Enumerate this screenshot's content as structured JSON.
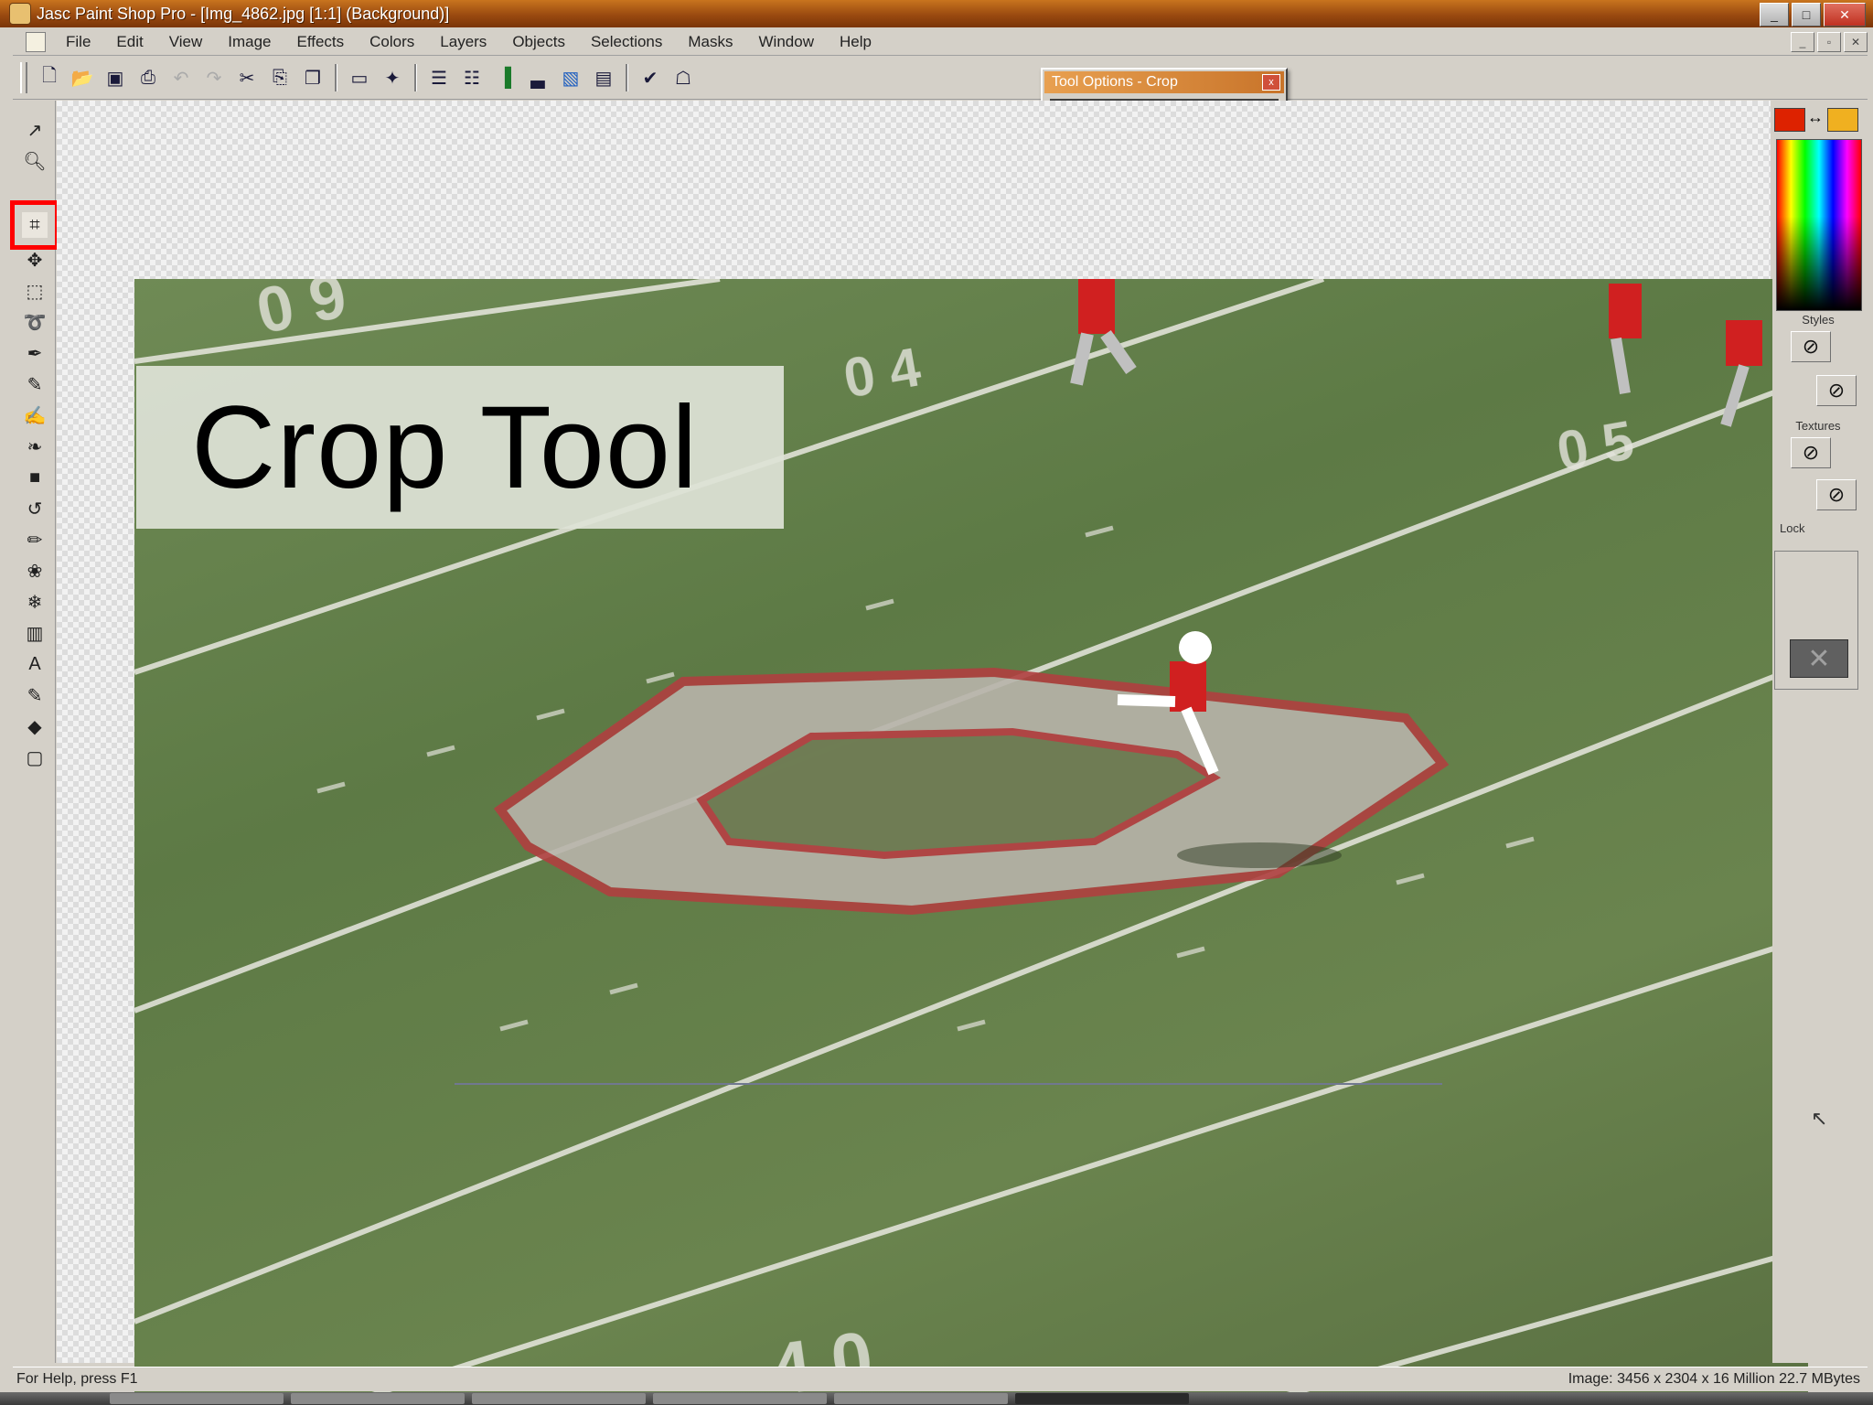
{
  "window": {
    "title": "Jasc Paint Shop Pro - [Img_4862.jpg [1:1] (Background)]",
    "controls": [
      "_",
      "□",
      "✕"
    ]
  },
  "menubar": {
    "items": [
      "File",
      "Edit",
      "View",
      "Image",
      "Effects",
      "Colors",
      "Layers",
      "Objects",
      "Selections",
      "Masks",
      "Window",
      "Help"
    ],
    "mdi_controls": [
      "_",
      "▫",
      "✕"
    ]
  },
  "toolbar": {
    "buttons": [
      "new-icon",
      "open-icon",
      "save-icon",
      "print-icon",
      "undo-icon",
      "redo-icon",
      "cut-icon",
      "copy-icon",
      "paste-icon",
      "screen-icon",
      "browse-icon",
      "tool-palette-icon",
      "tool-options-icon",
      "color-palette-icon",
      "histogram-icon",
      "layer-palette-icon",
      "overview-icon",
      "script-icon",
      "lock-icon"
    ]
  },
  "tool_options": {
    "title": "Tool Options - Crop",
    "close": "x"
  },
  "tools": [
    "selection-arrow-icon",
    "zoom-icon",
    "crop-icon",
    "mover-icon",
    "selection-icon",
    "lasso-icon",
    "dropper-icon",
    "paint-brush-icon",
    "clone-brush-icon",
    "color-replacer-icon",
    "retouch-icon",
    "scratch-remover-icon",
    "eraser-icon",
    "picture-tube-icon",
    "airbrush-icon",
    "flood-fill-icon",
    "text-icon",
    "draw-icon",
    "preset-shapes-icon",
    "object-selector-icon"
  ],
  "canvas": {
    "overlay_text": "Crop Tool"
  },
  "right_palette": {
    "styles_label": "Styles",
    "textures_label": "Textures",
    "lock_label": "Lock",
    "foreground_color": "#dd2200",
    "background_color": "#f0b020",
    "swap_icon": "swap-colors-icon"
  },
  "statusbar": {
    "help": "For Help, press F1",
    "image_info": "Image: 3456 x 2304 x 16 Million  22.7 MBytes"
  },
  "colors": {
    "titlebar": "#9a4a10",
    "highlight": "#ff0000",
    "field": "#647f4c"
  }
}
